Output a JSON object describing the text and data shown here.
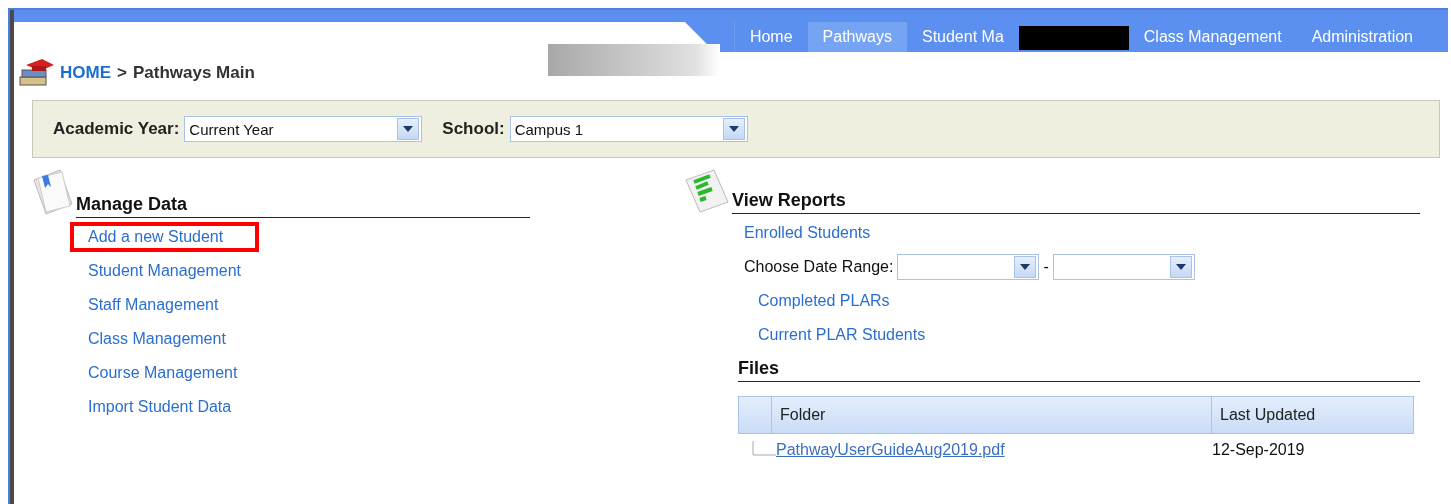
{
  "nav": {
    "tabs": [
      {
        "label": "Home",
        "selected": false
      },
      {
        "label": "Pathways",
        "selected": true
      },
      {
        "label": "Student Ma",
        "selected": false,
        "redacted_after": true
      },
      {
        "label": "Class Management",
        "selected": false
      },
      {
        "label": "Administration",
        "selected": false
      }
    ]
  },
  "breadcrumb": {
    "home": "HOME",
    "separator": ">",
    "current": "Pathways Main"
  },
  "filters": [
    {
      "label": "Academic Year:",
      "value": "Current Year"
    },
    {
      "label": "School:",
      "value": "Campus 1"
    }
  ],
  "manage_data": {
    "title": "Manage Data",
    "links": [
      {
        "label": "Add a new Student",
        "highlighted": true
      },
      {
        "label": "Student Management",
        "highlighted": false
      },
      {
        "label": "Staff Management",
        "highlighted": false
      },
      {
        "label": "Class Management",
        "highlighted": false
      },
      {
        "label": "Course Management",
        "highlighted": false
      },
      {
        "label": "Import Student Data",
        "highlighted": false
      }
    ]
  },
  "view_reports": {
    "title": "View Reports",
    "items": [
      {
        "kind": "link",
        "label": "Enrolled Students"
      },
      {
        "kind": "range",
        "label": "Choose Date Range:",
        "separator": "-"
      },
      {
        "kind": "sublink",
        "label": "Completed PLARs"
      },
      {
        "kind": "sublink",
        "label": "Current PLAR Students"
      }
    ]
  },
  "files": {
    "title": "Files",
    "columns": [
      "Folder",
      "Last Updated"
    ],
    "rows": [
      {
        "name": "PathwayUserGuideAug2019.pdf",
        "updated": "12-Sep-2019"
      }
    ]
  }
}
